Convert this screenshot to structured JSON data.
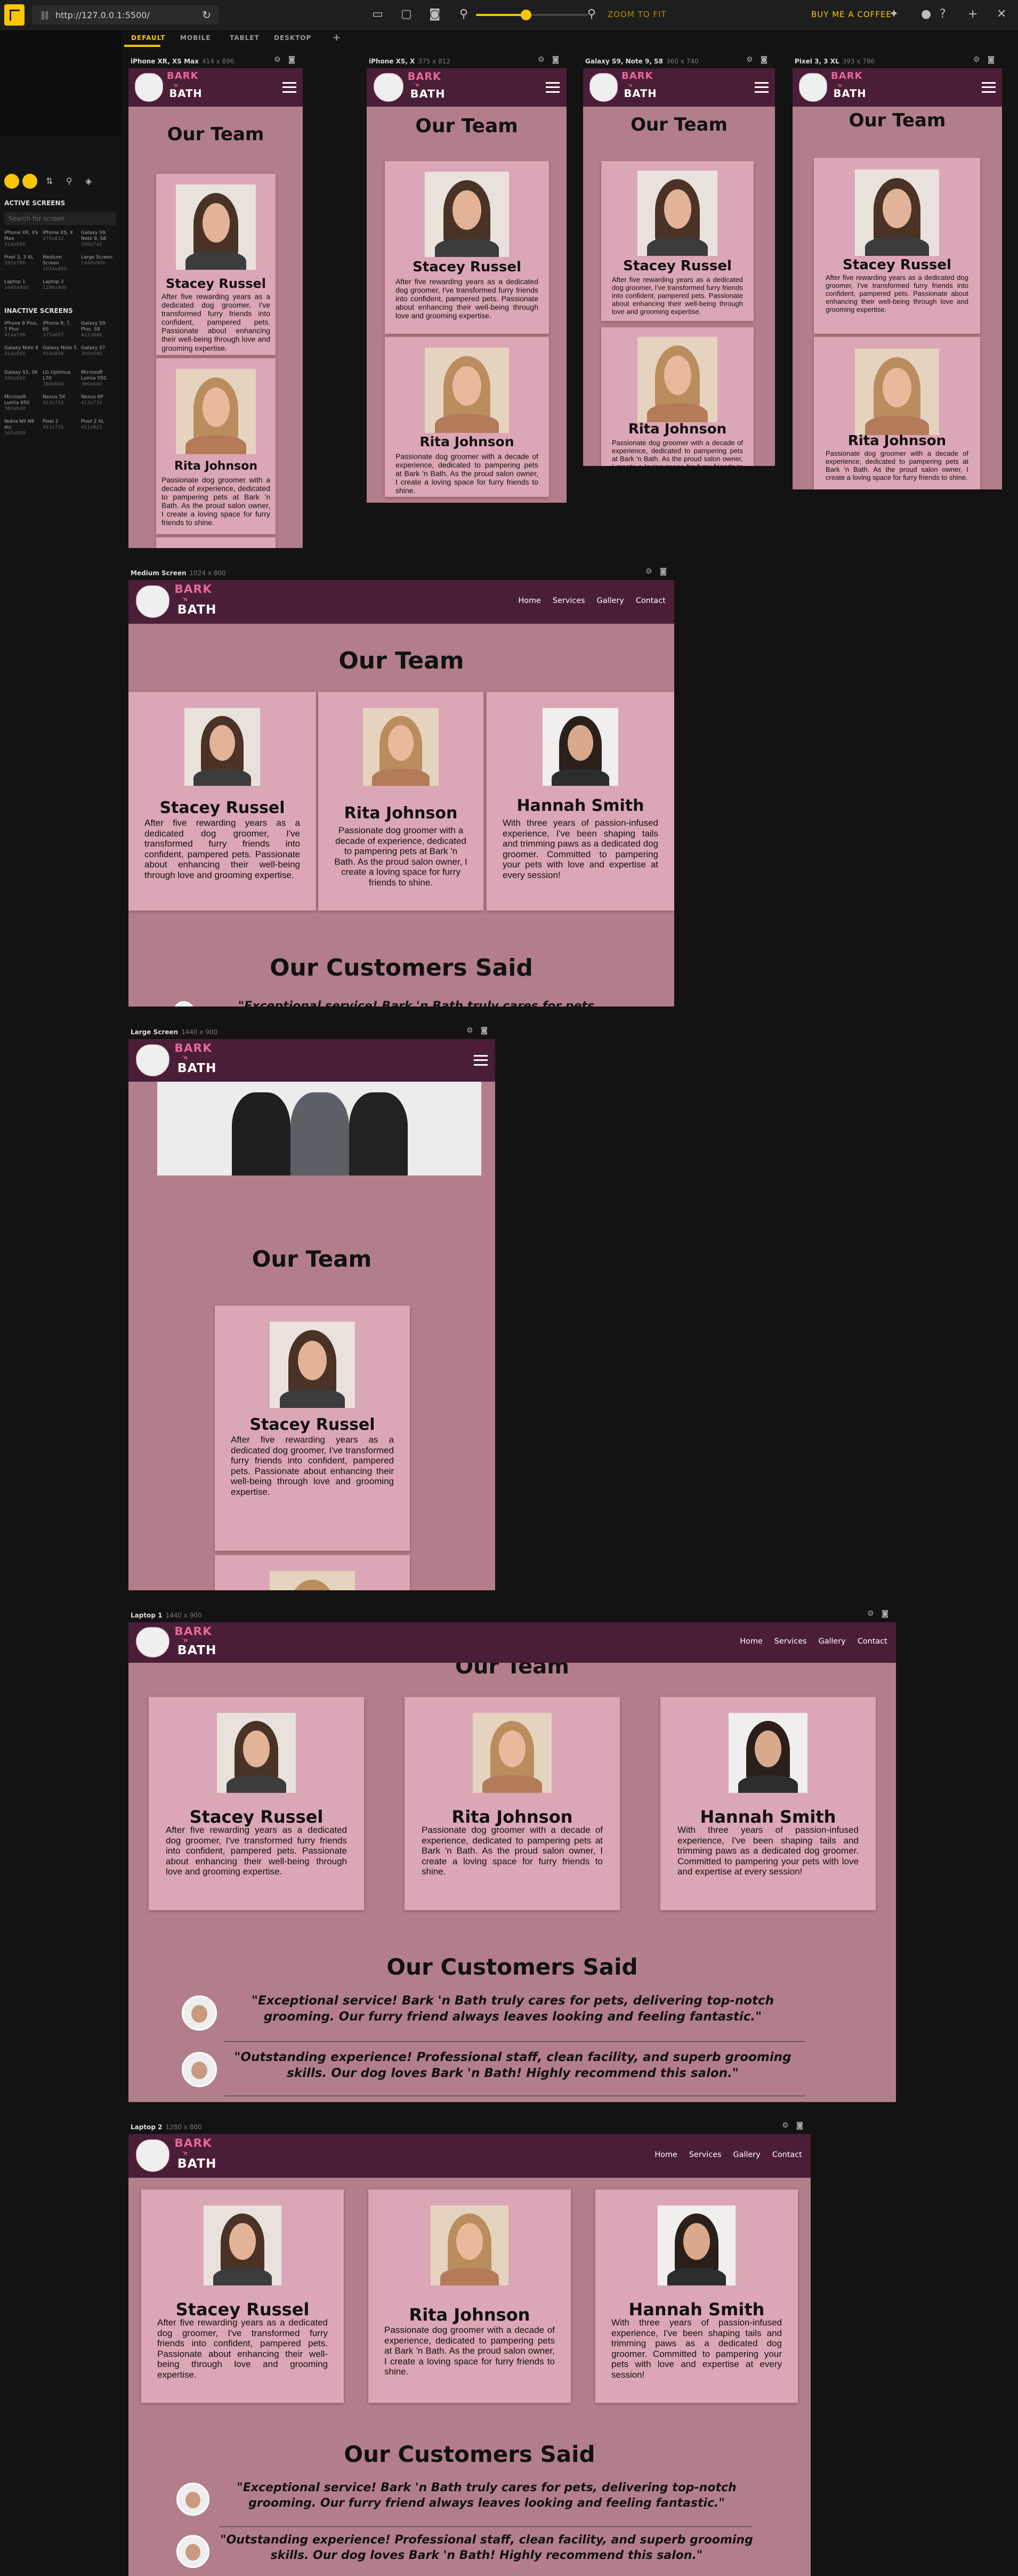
{
  "toolbar": {
    "url": "http://127.0.0.1:5500/",
    "zoom_label": "ZOOM TO FIT",
    "zoom_value": 0.16,
    "coffee_label": "BUY ME A COFFEE"
  },
  "tabs": [
    "DEFAULT",
    "MOBILE",
    "TABLET",
    "DESKTOP",
    "+"
  ],
  "left_panel": {
    "search_placeholder": "Search for screen",
    "active_title": "ACTIVE SCREENS",
    "inactive_title": "INACTIVE SCREENS",
    "active_screens": [
      {
        "name": "iPhone XR, XS Max",
        "dim": "414x896"
      },
      {
        "name": "iPhone XS, X",
        "dim": "375x812"
      },
      {
        "name": "Galaxy S9, Note 9, S8",
        "dim": "360x740"
      },
      {
        "name": "Pixel 3, 3 XL",
        "dim": "393x786"
      },
      {
        "name": "Medium Screen",
        "dim": "1024x800"
      },
      {
        "name": "Large Screen",
        "dim": "1440x900"
      },
      {
        "name": "Laptop 1",
        "dim": "1440x900"
      },
      {
        "name": "Laptop 2",
        "dim": "1280x800"
      }
    ],
    "inactive_screens": [
      {
        "name": "iPhone 8 Plus, 7 Plus",
        "dim": "414x736"
      },
      {
        "name": "iPhone 8, 7, 6S",
        "dim": "375x667"
      },
      {
        "name": "Galaxy S9 Plus, S8",
        "dim": "412x846"
      },
      {
        "name": "Galaxy Note 8",
        "dim": "414x846"
      },
      {
        "name": "Galaxy Note 5",
        "dim": "414x846"
      },
      {
        "name": "Galaxy S7",
        "dim": "360x640"
      },
      {
        "name": "Galaxy S5, S6",
        "dim": "360x640"
      },
      {
        "name": "LG Optimus L70",
        "dim": "384x640"
      },
      {
        "name": "Microsoft Lumia 550",
        "dim": "360x640"
      },
      {
        "name": "Microsoft Lumia 950",
        "dim": "360x640"
      },
      {
        "name": "Nexus 5X",
        "dim": "412x732"
      },
      {
        "name": "Nexus 6P",
        "dim": "412x732"
      },
      {
        "name": "Nokia N9 N8 etc",
        "dim": "360x640"
      },
      {
        "name": "Pixel 2",
        "dim": "411x731"
      },
      {
        "name": "Pixel 2 XL",
        "dim": "411x823"
      }
    ]
  },
  "site": {
    "brand_top": "BARK",
    "brand_mid": "'n",
    "brand_bottom": "BATH",
    "nav": [
      "Home",
      "Services",
      "Gallery",
      "Contact"
    ],
    "team_heading": "Our Team",
    "customers_heading": "Our Customers Said",
    "members": [
      {
        "name": "Stacey Russel",
        "bio": "After five rewarding years as a dedicated dog groomer, I've transformed furry friends into confident, pampered pets. Passionate about enhancing their well-being through love and grooming expertise."
      },
      {
        "name": "Rita Johnson",
        "bio": "Passionate dog groomer with a decade of experience, dedicated to pampering pets at Bark 'n Bath. As the proud salon owner, I create a loving space for furry friends to shine."
      },
      {
        "name": "Hannah Smith",
        "bio": "With three years of passion-infused experience, I've been shaping tails and trimming paws as a dedicated dog groomer. Committed to pampering your pets with love and expertise at every session!"
      }
    ],
    "quotes": [
      "\"Exceptional service! Bark 'n Bath truly cares for pets, delivering top-notch grooming. Our furry friend always leaves looking and feeling fantastic.\"",
      "\"Outstanding experience! Professional staff, clean facility, and superb grooming skills. Our dog loves Bark 'n Bath! Highly recommend this salon.\""
    ],
    "quote_partial": "\"Exceptional service! Bark 'n Bath truly cares for pets, delivering top-",
    "quote2_partial": "\"Outstanding experience! Professional staff, clean facility, and superb grooming skills. Our dog loves Bark 'n Bath! Highly recommend this salon.\""
  },
  "devices": [
    {
      "name": "iPhone XR, XS Max",
      "dim": "414 x 896"
    },
    {
      "name": "iPhone XS, X",
      "dim": "375 x 812"
    },
    {
      "name": "Galaxy S9, Note 9, S8",
      "dim": "360 x 740"
    },
    {
      "name": "Pixel 3, 3 XL",
      "dim": "393 x 786"
    },
    {
      "name": "Medium Screen",
      "dim": "1024 x 800"
    },
    {
      "name": "Large Screen",
      "dim": "1440 x 900"
    },
    {
      "name": "Laptop 1",
      "dim": "1440 x 900"
    },
    {
      "name": "Laptop 2",
      "dim": "1280 x 800"
    }
  ],
  "colors": {
    "accent": "#f7c600",
    "nav_bg": "#4b1e37",
    "page_bg": "#b27e8b",
    "card_bg": "#dba6b5",
    "brand_pink": "#e6689c"
  }
}
